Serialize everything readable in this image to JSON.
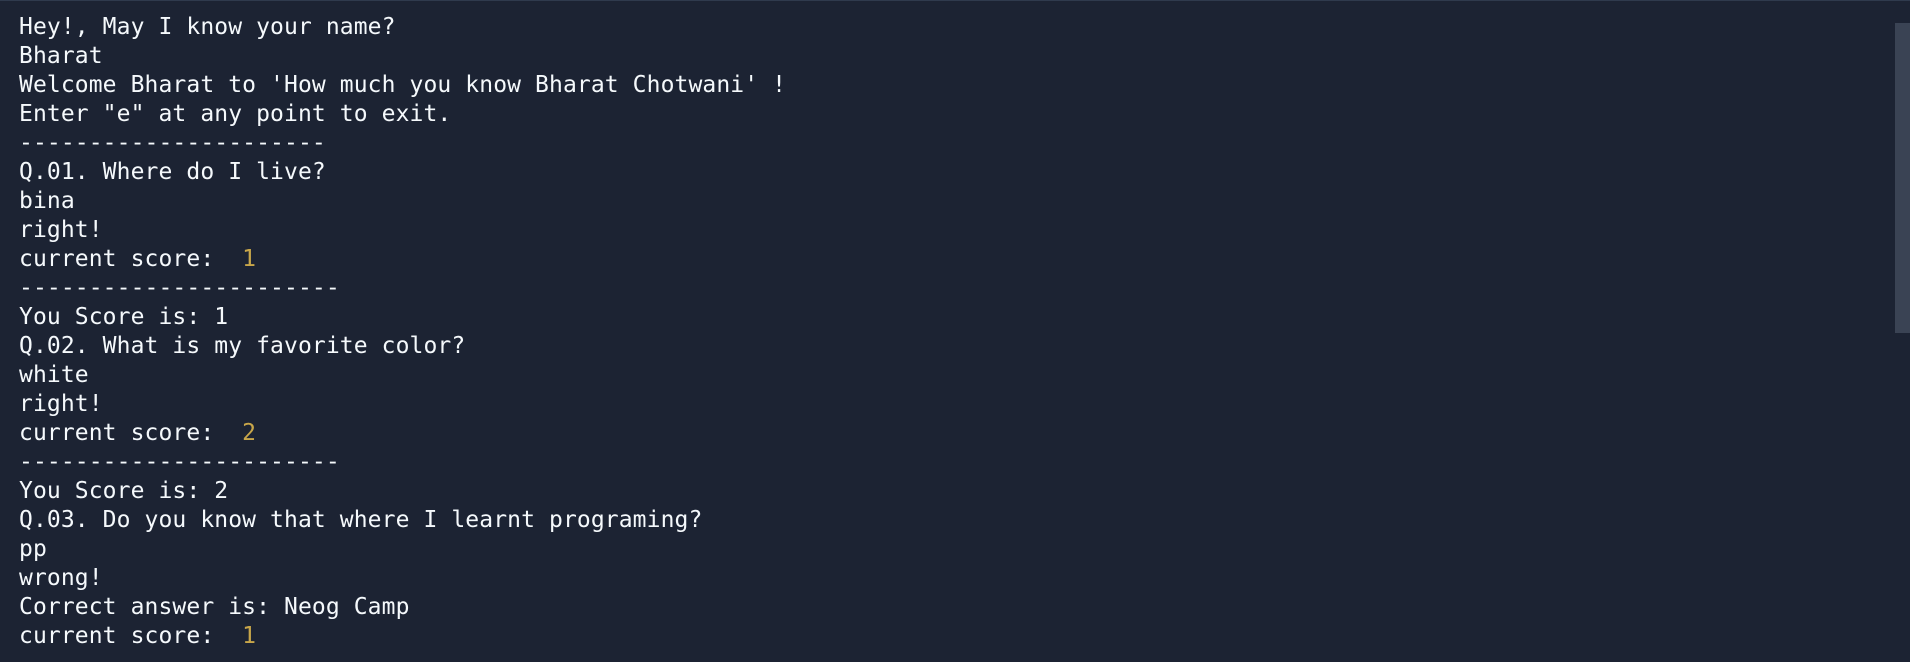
{
  "console": {
    "lines": [
      {
        "text": "Hey!, May I know your name?"
      },
      {
        "text": "Bharat"
      },
      {
        "text": "Welcome Bharat to 'How much you know Bharat Chotwani' !"
      },
      {
        "text": "Enter \"e\" at any point to exit."
      },
      {
        "text": "----------------------"
      },
      {
        "text": "Q.01. Where do I live?"
      },
      {
        "text": "bina"
      },
      {
        "text": "right!"
      },
      {
        "text": "current score:  ",
        "value": "1"
      },
      {
        "text": "-----------------------"
      },
      {
        "text": "You Score is: 1"
      },
      {
        "text": "Q.02. What is my favorite color?"
      },
      {
        "text": "white"
      },
      {
        "text": "right!"
      },
      {
        "text": "current score:  ",
        "value": "2"
      },
      {
        "text": "-----------------------"
      },
      {
        "text": "You Score is: 2"
      },
      {
        "text": "Q.03. Do you know that where I learnt programing?"
      },
      {
        "text": "pp"
      },
      {
        "text": "wrong!"
      },
      {
        "text": "Correct answer is: Neog Camp"
      },
      {
        "text": "current score:  ",
        "value": "1"
      }
    ]
  },
  "colors": {
    "background": "#1c2333",
    "text": "#f5f9fc",
    "number": "#c8a64a"
  }
}
